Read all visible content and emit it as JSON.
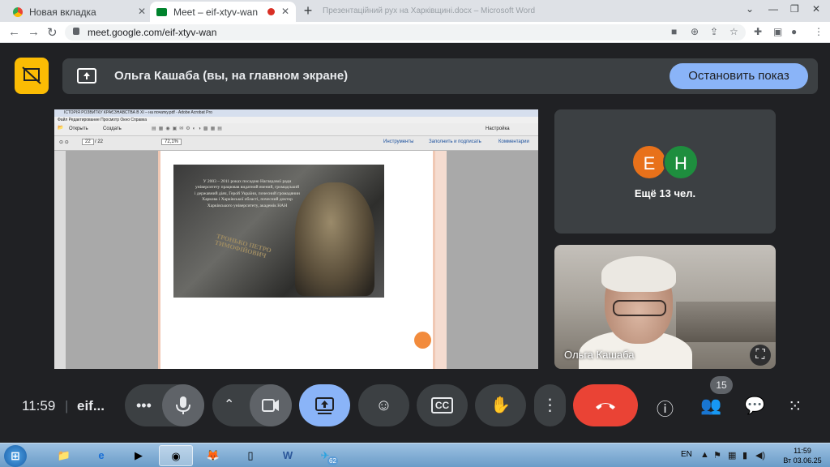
{
  "browser": {
    "tabs": [
      {
        "title": "Новая вкладка",
        "active": false
      },
      {
        "title": "Meet – eif-xtyv-wan",
        "active": true
      }
    ],
    "ghost_tab": "Презентаційний рух на Харківщині.docx – Microsoft Word",
    "url": "meet.google.com/eif-xtyv-wan"
  },
  "meet": {
    "banner_text": "Ольга Кашаба (вы, на главном экране)",
    "stop_button": "Остановить показ",
    "others_label": "Ещё 13 чел.",
    "avatars": [
      {
        "letter": "E",
        "color": "#e8711a"
      },
      {
        "letter": "H",
        "color": "#1e8e3e"
      }
    ],
    "self_name": "Ольга Кашаба",
    "time": "11:59",
    "separator": "|",
    "meeting_code": "eif...",
    "participants_count": "15"
  },
  "shared_screen": {
    "window_title": "ІСТОРІЯ РОЗВИТКУ КРАЄЗНАВСТВА В ХІ – на початку.pdf - Adobe Acrobat Pro",
    "menu": "Файл   Редактирование   Просмотр   Окно   Справка",
    "open_label": "Открыть",
    "create_label": "Создать",
    "customize_label": "Настройка",
    "page_current": "22",
    "page_total": "/ 22",
    "zoom": "72,1%",
    "panel_tools": "Инструменты",
    "panel_sign": "Заполнить и подписать",
    "panel_comments": "Комментарии",
    "plaque_text": "У 2003 – 2011 роках посадою Наглядової ради університету працював видатний вчений, громадський і державний діяч, Герой України, почесний громадянин Харкова і Харківської області, почесний доктор Харківського університету, академік НАН",
    "plaque_name": "ТРОНЬКО ПЕТРО ТИМОФІЙОВИЧ"
  },
  "taskbar": {
    "language": "EN",
    "telegram_badge": "62",
    "time": "11:59",
    "date": "Вт 03.06.25"
  },
  "colors": {
    "meet_bg": "#202124",
    "surface": "#3c4043",
    "accent_blue": "#8ab4f8",
    "end_call_red": "#ea4335",
    "present_yellow": "#fbbc04"
  }
}
